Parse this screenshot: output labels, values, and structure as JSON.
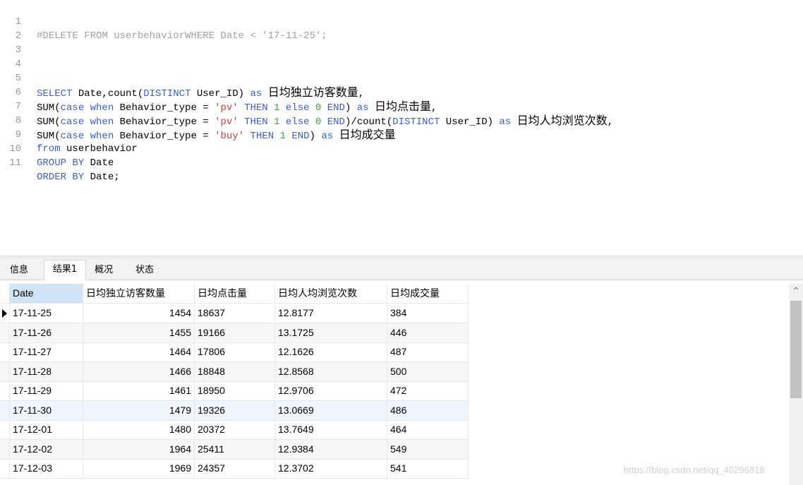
{
  "editor": {
    "line_numbers": [
      "1",
      "2",
      "3",
      "4",
      "5",
      "6",
      "7",
      "8",
      "9",
      "10",
      "11"
    ],
    "l1": "#DELETE FROM userbehaviorWHERE Date < '17-11-25';",
    "l5": {
      "kw1": "SELECT",
      "t1": " Date,count(",
      "kw2": "DISTINCT",
      "t2": " User_ID) ",
      "kw3": "as",
      "t3": " ",
      "cn": "日均独立访客数量",
      "t4": ","
    },
    "l6": {
      "t1": "SUM(",
      "kw1": "case",
      "t2": " ",
      "kw2": "when",
      "t3": " Behavior_type = ",
      "s1": "'pv'",
      "t4": " ",
      "kw3": "THEN",
      "t5": " ",
      "n1": "1",
      "t6": " ",
      "kw4": "else",
      "t7": " ",
      "n2": "0",
      "t8": " ",
      "kw5": "END",
      "t9": ") ",
      "kw6": "as",
      "t10": " ",
      "cn": "日均点击量",
      "t11": ","
    },
    "l7": {
      "t1": "SUM(",
      "kw1": "case",
      "t2": " ",
      "kw2": "when",
      "t3": " Behavior_type = ",
      "s1": "'pv'",
      "t4": " ",
      "kw3": "THEN",
      "t5": " ",
      "n1": "1",
      "t6": " ",
      "kw4": "else",
      "t7": " ",
      "n2": "0",
      "t8": " ",
      "kw5": "END",
      "t9": ")/count(",
      "kw6": "DISTINCT",
      "t10": " User_ID) ",
      "kw7": "as",
      "t11": " ",
      "cn": "日均人均浏览次数",
      "t12": ","
    },
    "l8": {
      "t1": "SUM(",
      "kw1": "case",
      "t2": " ",
      "kw2": "when",
      "t3": " Behavior_type = ",
      "s1": "'buy'",
      "t4": " ",
      "kw3": "THEN",
      "t5": " ",
      "n1": "1",
      "t6": " ",
      "kw4": "END",
      "t7": ") ",
      "kw5": "as",
      "t8": " ",
      "cn": "日均成交量"
    },
    "l9": {
      "kw1": "from",
      "t1": " userbehavior"
    },
    "l10": {
      "kw1": "GROUP BY",
      "t1": " Date"
    },
    "l11": {
      "kw1": "ORDER BY",
      "t1": " Date;"
    }
  },
  "tabs": [
    "信息",
    "结果1",
    "概况",
    "状态"
  ],
  "grid": {
    "columns": [
      "Date",
      "日均独立访客数量",
      "日均点击量",
      "日均人均浏览次数",
      "日均成交量"
    ],
    "rows": [
      [
        "17-11-25",
        "1454",
        "18637",
        "12.8177",
        "384"
      ],
      [
        "17-11-26",
        "1455",
        "19166",
        "13.1725",
        "446"
      ],
      [
        "17-11-27",
        "1464",
        "17806",
        "12.1626",
        "487"
      ],
      [
        "17-11-28",
        "1466",
        "18848",
        "12.8568",
        "500"
      ],
      [
        "17-11-29",
        "1461",
        "18950",
        "12.9706",
        "472"
      ],
      [
        "17-11-30",
        "1479",
        "19326",
        "13.0669",
        "486"
      ],
      [
        "17-12-01",
        "1480",
        "20372",
        "13.7649",
        "464"
      ],
      [
        "17-12-02",
        "1964",
        "25411",
        "12.9384",
        "549"
      ],
      [
        "17-12-03",
        "1969",
        "24357",
        "12.3702",
        "541"
      ]
    ]
  },
  "watermark": "https://blog.csdn.net/qq_40296818",
  "colors": {
    "keyword": "#3a5dd6",
    "string": "#d04040",
    "number": "#3aa83a",
    "comment": "#a0a0a0",
    "header_selected": "#cfe4f6"
  }
}
